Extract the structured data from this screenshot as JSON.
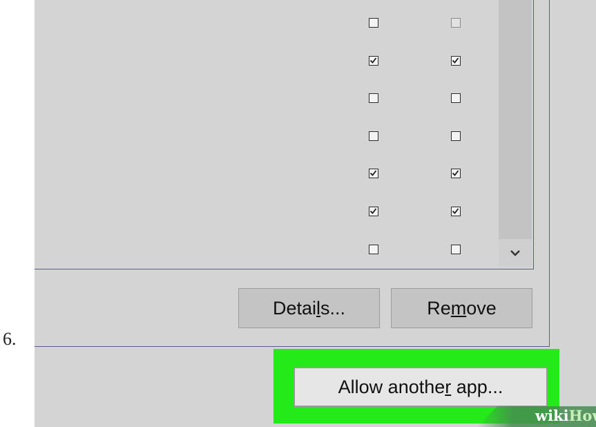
{
  "step_number": "6.",
  "checkbox_rows": [
    {
      "private": false,
      "public": false,
      "public_enabled": false
    },
    {
      "private": true,
      "public": true,
      "public_enabled": true
    },
    {
      "private": false,
      "public": false,
      "public_enabled": true
    },
    {
      "private": false,
      "public": false,
      "public_enabled": true
    },
    {
      "private": true,
      "public": true,
      "public_enabled": true
    },
    {
      "private": true,
      "public": true,
      "public_enabled": true
    },
    {
      "private": false,
      "public": false,
      "public_enabled": true
    }
  ],
  "buttons": {
    "details": {
      "before": "Detai",
      "mnemonic": "l",
      "after": "s..."
    },
    "remove": {
      "before": "Re",
      "mnemonic": "m",
      "after": "ove"
    },
    "allow": {
      "before": "Allow anothe",
      "mnemonic": "r",
      "after": " app..."
    }
  },
  "highlight_color": "#25ea1a",
  "watermark": {
    "wiki": "wiki",
    "how": "How"
  },
  "icons": {
    "scroll_down": "chevron-down-icon",
    "check": "checkmark-icon"
  }
}
